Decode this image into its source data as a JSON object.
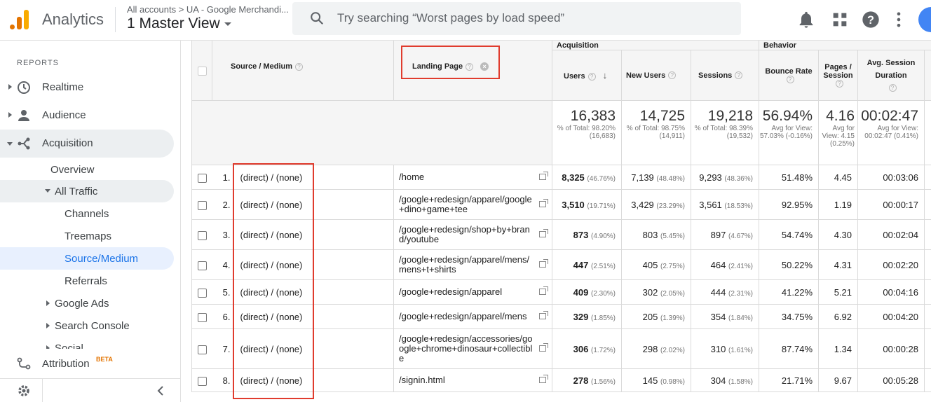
{
  "topbar": {
    "app_title": "Analytics",
    "breadcrumb": "All accounts  >  UA - Google Merchandi...",
    "view": "1 Master View",
    "search_placeholder": "Try searching “Worst pages by load speed”"
  },
  "sidebar": {
    "heading": "REPORTS",
    "items": [
      {
        "label": "Realtime"
      },
      {
        "label": "Audience"
      },
      {
        "label": "Acquisition"
      },
      {
        "label": "Overview"
      },
      {
        "label": "All Traffic"
      },
      {
        "label": "Channels"
      },
      {
        "label": "Treemaps"
      },
      {
        "label": "Source/Medium"
      },
      {
        "label": "Referrals"
      },
      {
        "label": "Google Ads"
      },
      {
        "label": "Search Console"
      },
      {
        "label": "Social"
      }
    ],
    "attribution": "Attribution",
    "attribution_badge": "BETA"
  },
  "table": {
    "group_headers": {
      "acquisition": "Acquisition",
      "behavior": "Behavior"
    },
    "headers": {
      "source_medium": "Source / Medium",
      "landing_page": "Landing Page",
      "users": "Users",
      "new_users": "New Users",
      "sessions": "Sessions",
      "bounce_rate": "Bounce Rate",
      "pages_session": "Pages / Session",
      "avg_duration": "Avg. Session Duration"
    },
    "totals": {
      "users": "16,383",
      "users_sub": "% of Total: 98.20% (16,683)",
      "new_users": "14,725",
      "new_users_sub": "% of Total: 98.75% (14,911)",
      "sessions": "19,218",
      "sessions_sub": "% of Total: 98.39% (19,532)",
      "bounce_rate": "56.94%",
      "bounce_rate_sub": "Avg for View: 57.03% (-0.16%)",
      "pages_session": "4.16",
      "pages_session_sub": "Avg for View: 4.15 (0.25%)",
      "avg_duration": "00:02:47",
      "avg_duration_sub": "Avg for View: 00:02:47 (0.41%)"
    },
    "rows": [
      {
        "idx": "1.",
        "source": "(direct) / (none)",
        "page": "/home",
        "users": "8,325",
        "users_pct": "(46.76%)",
        "new_users": "7,139",
        "new_users_pct": "(48.48%)",
        "sessions": "9,293",
        "sessions_pct": "(48.36%)",
        "bounce": "51.48%",
        "pages": "4.45",
        "duration": "00:03:06"
      },
      {
        "idx": "2.",
        "source": "(direct) / (none)",
        "page": "/google+redesign/apparel/google+dino+game+tee",
        "users": "3,510",
        "users_pct": "(19.71%)",
        "new_users": "3,429",
        "new_users_pct": "(23.29%)",
        "sessions": "3,561",
        "sessions_pct": "(18.53%)",
        "bounce": "92.95%",
        "pages": "1.19",
        "duration": "00:00:17"
      },
      {
        "idx": "3.",
        "source": "(direct) / (none)",
        "page": "/google+redesign/shop+by+brand/youtube",
        "users": "873",
        "users_pct": "(4.90%)",
        "new_users": "803",
        "new_users_pct": "(5.45%)",
        "sessions": "897",
        "sessions_pct": "(4.67%)",
        "bounce": "54.74%",
        "pages": "4.30",
        "duration": "00:02:04"
      },
      {
        "idx": "4.",
        "source": "(direct) / (none)",
        "page": "/google+redesign/apparel/mens/mens+t+shirts",
        "users": "447",
        "users_pct": "(2.51%)",
        "new_users": "405",
        "new_users_pct": "(2.75%)",
        "sessions": "464",
        "sessions_pct": "(2.41%)",
        "bounce": "50.22%",
        "pages": "4.31",
        "duration": "00:02:20"
      },
      {
        "idx": "5.",
        "source": "(direct) / (none)",
        "page": "/google+redesign/apparel",
        "users": "409",
        "users_pct": "(2.30%)",
        "new_users": "302",
        "new_users_pct": "(2.05%)",
        "sessions": "444",
        "sessions_pct": "(2.31%)",
        "bounce": "41.22%",
        "pages": "5.21",
        "duration": "00:04:16"
      },
      {
        "idx": "6.",
        "source": "(direct) / (none)",
        "page": "/google+redesign/apparel/mens",
        "users": "329",
        "users_pct": "(1.85%)",
        "new_users": "205",
        "new_users_pct": "(1.39%)",
        "sessions": "354",
        "sessions_pct": "(1.84%)",
        "bounce": "34.75%",
        "pages": "6.92",
        "duration": "00:04:20"
      },
      {
        "idx": "7.",
        "source": "(direct) / (none)",
        "page": "/google+redesign/accessories/google+chrome+dinosaur+collectible",
        "users": "306",
        "users_pct": "(1.72%)",
        "new_users": "298",
        "new_users_pct": "(2.02%)",
        "sessions": "310",
        "sessions_pct": "(1.61%)",
        "bounce": "87.74%",
        "pages": "1.34",
        "duration": "00:00:28"
      },
      {
        "idx": "8.",
        "source": "(direct) / (none)",
        "page": "/signin.html",
        "users": "278",
        "users_pct": "(1.56%)",
        "new_users": "145",
        "new_users_pct": "(0.98%)",
        "sessions": "304",
        "sessions_pct": "(1.58%)",
        "bounce": "21.71%",
        "pages": "9.67",
        "duration": "00:05:28"
      }
    ]
  }
}
